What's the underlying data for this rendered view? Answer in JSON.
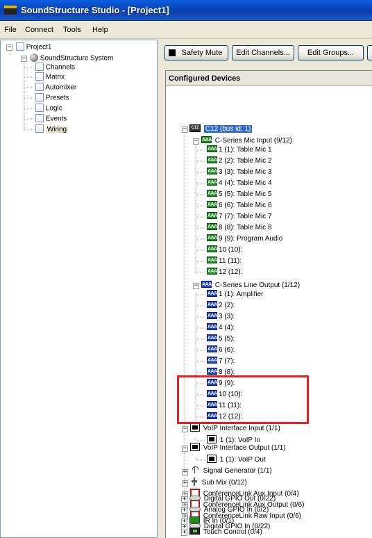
{
  "window": {
    "title": "SoundStructure Studio - [Project1]"
  },
  "menu": [
    {
      "label": "File",
      "name": "menu-file"
    },
    {
      "label": "Connect",
      "name": "menu-connect"
    },
    {
      "label": "Tools",
      "name": "menu-tools"
    },
    {
      "label": "Help",
      "name": "menu-help"
    }
  ],
  "left_tree": {
    "root": "Project1",
    "system": "SoundStructure System",
    "items": [
      "Channels",
      "Matrix",
      "Automixer",
      "Presets",
      "Logic",
      "Events",
      "Wiring"
    ],
    "selected": "Wiring"
  },
  "toolbar": {
    "safety_mute": "Safety Mute",
    "edit_channels": "Edit Channels...",
    "edit_groups": "Edit Groups..."
  },
  "devices": {
    "header": "Configured Devices",
    "device": {
      "icon_label": "C12",
      "label": "C12 (bus id: 1)"
    },
    "mic_input": {
      "label": "C-Series Mic Input (9/12)",
      "children": [
        "1 (1): Table Mic 1",
        "2 (2): Table Mic 2",
        "3 (3): Table Mic 3",
        "4 (4): Table Mic 4",
        "5 (5): Table Mic 5",
        "6 (6): Table Mic 6",
        "7 (7): Table Mic 7",
        "8 (8): Table Mic 8",
        "9 (9): Program Audio",
        "10 (10):",
        "11 (11):",
        "12 (12):"
      ]
    },
    "line_output": {
      "label": "C-Series Line Output (1/12)",
      "children": [
        "1 (1): Amplifier",
        "2 (2):",
        "3 (3):",
        "4 (4):",
        "5 (5):",
        "6 (6):",
        "7 (7):",
        "8 (8):",
        "9 (9):",
        "10 (10):",
        "11 (11):",
        "12 (12):"
      ]
    },
    "voip_input": {
      "label": "VoIP Interface Input (1/1)",
      "child": "1 (1): VoIP In"
    },
    "voip_output": {
      "label": "VoIP Interface Output (1/1)",
      "child": "1 (1): VoIP Out"
    },
    "collapsed": [
      {
        "label": "Signal Generator (1/1)",
        "icon": "signal-generator-icon"
      },
      {
        "label": "Sub Mix (0/12)",
        "icon": "submix-icon"
      },
      {
        "label": "ConferenceLink Aux Input (0/4)",
        "icon": "conferencelink-icon"
      },
      {
        "label": "ConferenceLink Aux Output (0/6)",
        "icon": "conferencelink-icon"
      },
      {
        "label": "ConferenceLink Raw Input (0/6)",
        "icon": "conferencelink-icon"
      },
      {
        "label": "Digital GPIO In (0/22)",
        "icon": "gpio-icon"
      },
      {
        "label": "Digital GPIO Out (0/22)",
        "icon": "gpio-icon"
      },
      {
        "label": "Analog GPIO In (0/2)",
        "icon": "gpio-icon"
      },
      {
        "label": "IR In (0/1)",
        "icon": "ir-icon"
      },
      {
        "label": "Touch Control (0/4)",
        "icon": "touch-control-icon"
      }
    ]
  },
  "colors": {
    "selection": "#316ac5",
    "highlight_box": "#e8201c",
    "mic_icon": "#1e8c1e",
    "output_icon": "#1a3cc8"
  }
}
